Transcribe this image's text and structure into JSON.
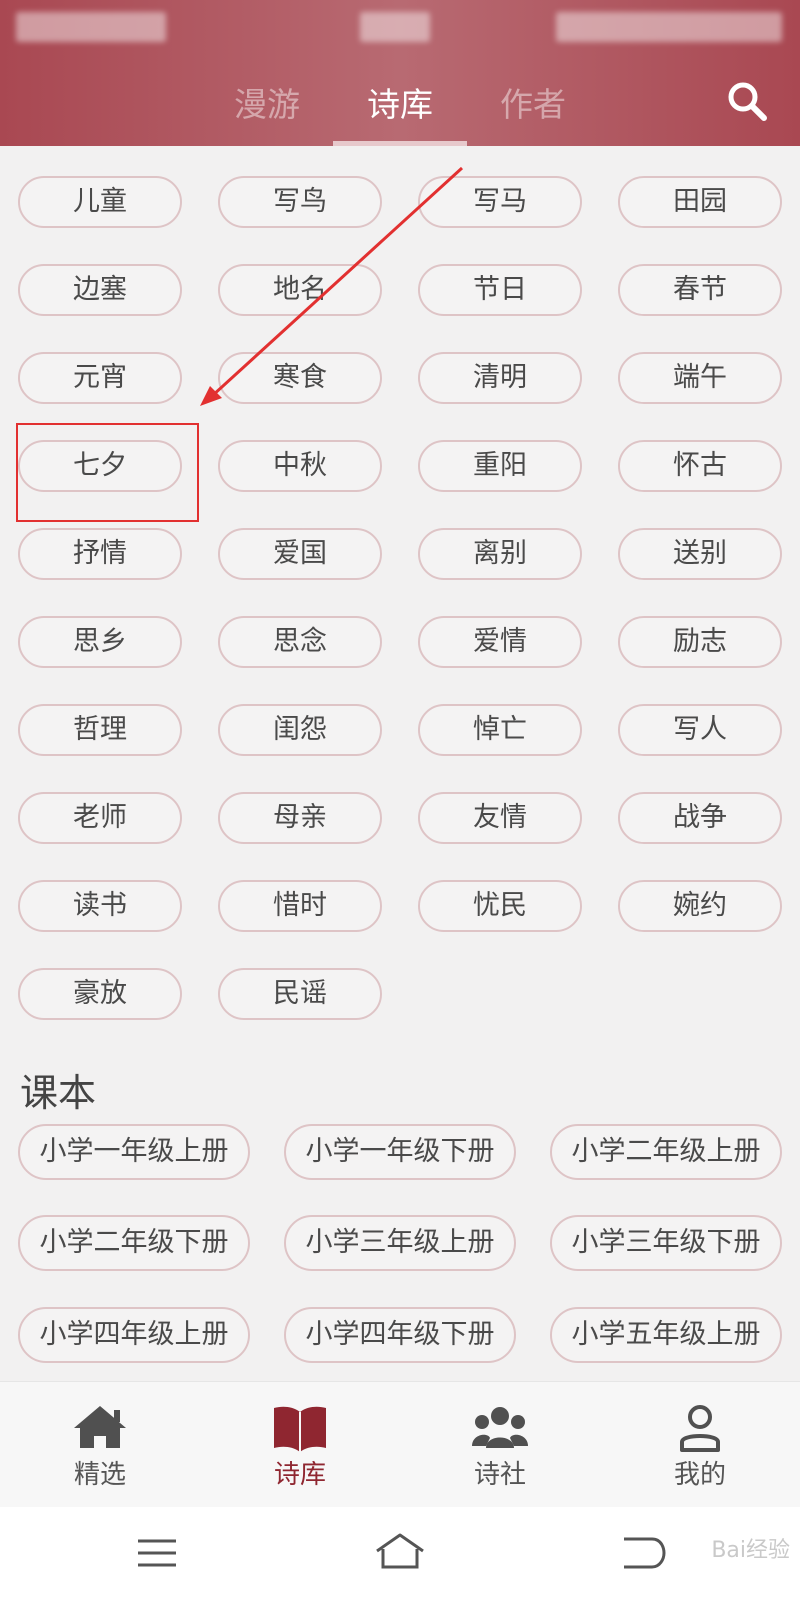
{
  "header": {
    "tabs": [
      {
        "label": "漫游",
        "active": false
      },
      {
        "label": "诗库",
        "active": true
      },
      {
        "label": "作者",
        "active": false
      }
    ],
    "search_icon": "search-icon"
  },
  "tags": [
    "儿童",
    "写鸟",
    "写马",
    "田园",
    "边塞",
    "地名",
    "节日",
    "春节",
    "元宵",
    "寒食",
    "清明",
    "端午",
    "七夕",
    "中秋",
    "重阳",
    "怀古",
    "抒情",
    "爱国",
    "离别",
    "送别",
    "思乡",
    "思念",
    "爱情",
    "励志",
    "哲理",
    "闺怨",
    "悼亡",
    "写人",
    "老师",
    "母亲",
    "友情",
    "战争",
    "读书",
    "惜时",
    "忧民",
    "婉约",
    "豪放",
    "民谣"
  ],
  "textbook": {
    "title": "课本",
    "items": [
      "小学一年级上册",
      "小学一年级下册",
      "小学二年级上册",
      "小学二年级下册",
      "小学三年级上册",
      "小学三年级下册",
      "小学四年级上册",
      "小学四年级下册",
      "小学五年级上册"
    ]
  },
  "bottom_nav": [
    {
      "label": "精选",
      "icon": "home-icon",
      "active": false
    },
    {
      "label": "诗库",
      "icon": "book-icon",
      "active": true
    },
    {
      "label": "诗社",
      "icon": "users-icon",
      "active": false
    },
    {
      "label": "我的",
      "icon": "user-icon",
      "active": false
    }
  ],
  "system_nav": [
    "menu-icon",
    "home-outline-icon",
    "back-icon"
  ],
  "watermark": "Bai经验",
  "colors": {
    "header": "#a94852",
    "accent": "#8f2630",
    "chip_border": "#dec4c6",
    "annotation": "#e23030"
  }
}
